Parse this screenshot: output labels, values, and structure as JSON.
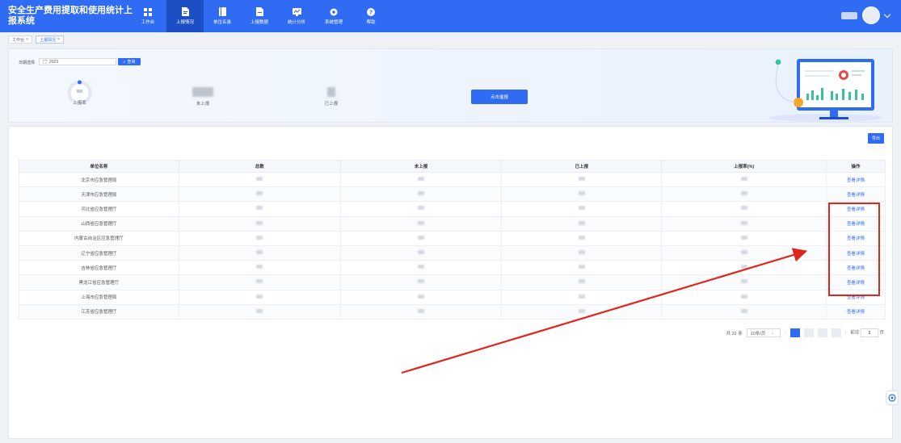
{
  "header": {
    "app_title": "安全生产费用提取和使用统计上报系统",
    "nav": [
      {
        "label": "工作台",
        "icon": "grid-icon",
        "active": false
      },
      {
        "label": "上报情况",
        "icon": "report-icon",
        "active": true
      },
      {
        "label": "单位名录",
        "icon": "book-icon",
        "active": false
      },
      {
        "label": "上报数据",
        "icon": "document-icon",
        "active": false
      },
      {
        "label": "统计分析",
        "icon": "chart-icon",
        "active": false
      },
      {
        "label": "系统管理",
        "icon": "gear-icon",
        "active": false
      },
      {
        "label": "帮助",
        "icon": "help-icon",
        "active": false
      }
    ]
  },
  "tabs": [
    {
      "label": "工作台",
      "active": false
    },
    {
      "label": "上报情况",
      "active": true
    }
  ],
  "filter": {
    "year_label": "日期选择",
    "year_value": "2023",
    "query_label": "查询"
  },
  "stats": {
    "ring_label": "上报率",
    "not_reported_label": "未上报",
    "reported_label": "已上报",
    "report_button": "点击催报"
  },
  "export_label": "导出",
  "table": {
    "columns": [
      "单位名称",
      "总数",
      "未上报",
      "已上报",
      "上报率(%)",
      "操作"
    ],
    "action_label": "查看详情",
    "rows": [
      "北京市应急管理局",
      "天津市应急管理局",
      "河北省应急管理厅",
      "山西省应急管理厅",
      "内蒙古自治区应急管理厅",
      "辽宁省应急管理厅",
      "吉林省应急管理厅",
      "黑龙江省应急管理厅",
      "上海市应急管理局",
      "江苏省应急管理厅"
    ]
  },
  "pager": {
    "total": "共 32 条",
    "page_size": "10条/页",
    "goto_label": "前往",
    "goto_value": "1",
    "page_unit": "页"
  },
  "colors": {
    "primary": "#2f6bf3",
    "annotation": "#e0251d"
  }
}
